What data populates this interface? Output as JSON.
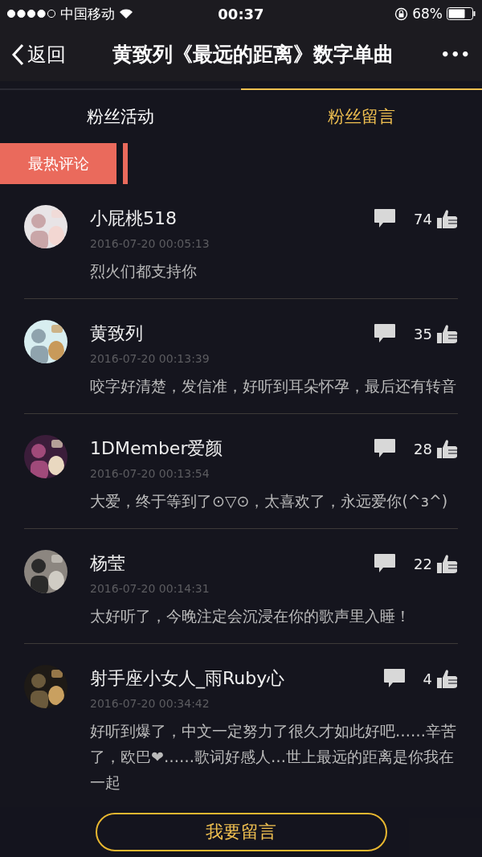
{
  "status_bar": {
    "carrier": "中国移动",
    "time": "00:37",
    "battery": "68%"
  },
  "nav": {
    "back": "返回",
    "title": "黄致列《最远的距离》数字单曲",
    "more": "•••"
  },
  "tabs": [
    {
      "label": "粉丝活动",
      "selected": false
    },
    {
      "label": "粉丝留言",
      "selected": true
    }
  ],
  "section_label": "最热评论",
  "comments": [
    {
      "user": "小屁桃518",
      "time": "2016-07-20 00:05:13",
      "likes": "74",
      "text": "烈火们都支持你"
    },
    {
      "user": "黄致列",
      "time": "2016-07-20 00:13:39",
      "likes": "35",
      "text": "咬字好清楚，发信准，好听到耳朵怀孕，最后还有转音"
    },
    {
      "user": "1DMember爱颜",
      "time": "2016-07-20 00:13:54",
      "likes": "28",
      "text": "大爱，终于等到了⊙▽⊙，太喜欢了，永远爱你(^з^)"
    },
    {
      "user": "杨莹",
      "time": "2016-07-20 00:14:31",
      "likes": "22",
      "text": "太好听了，今晚注定会沉浸在你的歌声里入睡！"
    },
    {
      "user": "射手座小女人_雨Ruby心",
      "time": "2016-07-20 00:34:42",
      "likes": "4",
      "text": "好听到爆了，中文一定努力了很久才如此好吧……辛苦了，欧巴❤……歌词好感人…世上最远的距离是你我在一起"
    }
  ],
  "footer_button": "我要留言"
}
